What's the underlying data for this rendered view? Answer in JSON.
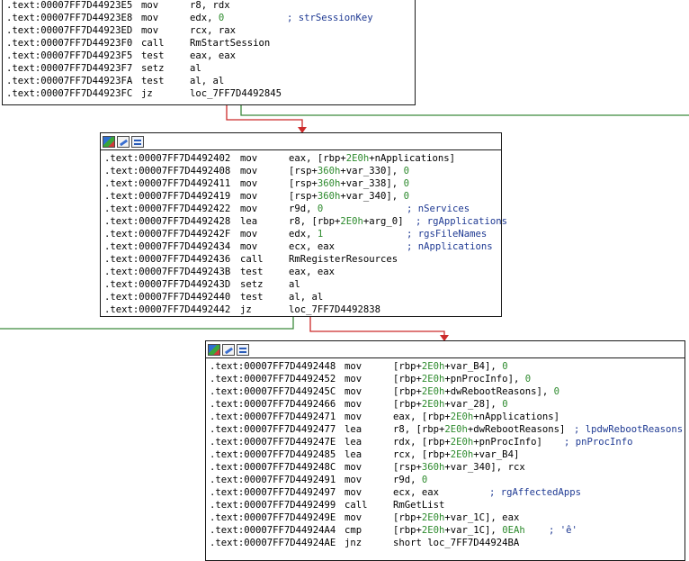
{
  "colors": {
    "edge_true": "#3c8a3c",
    "edge_false": "#cc2a2a",
    "border": "#1a1a1a",
    "text": "#000000",
    "number": "#2d8a2d",
    "comment": "#1f3a93"
  },
  "toolbar_icons": [
    "color-icon",
    "edit-node-icon",
    "graph-view-icon"
  ],
  "blocks": [
    {
      "id": "block1",
      "lines": [
        {
          "addr": ".text:00007FF7D44923E5",
          "mnem": "mov",
          "ops": "r8, rdx",
          "comment": ""
        },
        {
          "addr": ".text:00007FF7D44923E8",
          "mnem": "mov",
          "ops": "edx, 0",
          "comment": "; strSessionKey"
        },
        {
          "addr": ".text:00007FF7D44923ED",
          "mnem": "mov",
          "ops": "rcx, rax",
          "comment": ""
        },
        {
          "addr": ".text:00007FF7D44923F0",
          "mnem": "call",
          "ops": "RmStartSession",
          "comment": ""
        },
        {
          "addr": ".text:00007FF7D44923F5",
          "mnem": "test",
          "ops": "eax, eax",
          "comment": ""
        },
        {
          "addr": ".text:00007FF7D44923F7",
          "mnem": "setz",
          "ops": "al",
          "comment": ""
        },
        {
          "addr": ".text:00007FF7D44923FA",
          "mnem": "test",
          "ops": "al, al",
          "comment": ""
        },
        {
          "addr": ".text:00007FF7D44923FC",
          "mnem": "jz",
          "ops": "loc_7FF7D4492845",
          "comment": ""
        }
      ]
    },
    {
      "id": "block2",
      "lines": [
        {
          "addr": ".text:00007FF7D4492402",
          "mnem": "mov",
          "ops": "eax, [rbp+2E0h+nApplications]",
          "comment": ""
        },
        {
          "addr": ".text:00007FF7D4492408",
          "mnem": "mov",
          "ops": "[rsp+360h+var_330], 0",
          "comment": ""
        },
        {
          "addr": ".text:00007FF7D4492411",
          "mnem": "mov",
          "ops": "[rsp+360h+var_338], 0",
          "comment": ""
        },
        {
          "addr": ".text:00007FF7D4492419",
          "mnem": "mov",
          "ops": "[rsp+360h+var_340], 0",
          "comment": ""
        },
        {
          "addr": ".text:00007FF7D4492422",
          "mnem": "mov",
          "ops": "r9d, 0",
          "comment": "; nServices"
        },
        {
          "addr": ".text:00007FF7D4492428",
          "mnem": "lea",
          "ops": "r8, [rbp+2E0h+arg_0]",
          "comment": "; rgApplications"
        },
        {
          "addr": ".text:00007FF7D449242F",
          "mnem": "mov",
          "ops": "edx, 1",
          "comment": "; rgsFileNames"
        },
        {
          "addr": ".text:00007FF7D4492434",
          "mnem": "mov",
          "ops": "ecx, eax",
          "comment": "; nApplications"
        },
        {
          "addr": ".text:00007FF7D4492436",
          "mnem": "call",
          "ops": "RmRegisterResources",
          "comment": ""
        },
        {
          "addr": ".text:00007FF7D449243B",
          "mnem": "test",
          "ops": "eax, eax",
          "comment": ""
        },
        {
          "addr": ".text:00007FF7D449243D",
          "mnem": "setz",
          "ops": "al",
          "comment": ""
        },
        {
          "addr": ".text:00007FF7D4492440",
          "mnem": "test",
          "ops": "al, al",
          "comment": ""
        },
        {
          "addr": ".text:00007FF7D4492442",
          "mnem": "jz",
          "ops": "loc_7FF7D4492838",
          "comment": ""
        }
      ]
    },
    {
      "id": "block3",
      "lines": [
        {
          "addr": ".text:00007FF7D4492448",
          "mnem": "mov",
          "ops": "[rbp+2E0h+var_B4], 0",
          "comment": ""
        },
        {
          "addr": ".text:00007FF7D4492452",
          "mnem": "mov",
          "ops": "[rbp+2E0h+pnProcInfo], 0",
          "comment": ""
        },
        {
          "addr": ".text:00007FF7D449245C",
          "mnem": "mov",
          "ops": "[rbp+2E0h+dwRebootReasons], 0",
          "comment": ""
        },
        {
          "addr": ".text:00007FF7D4492466",
          "mnem": "mov",
          "ops": "[rbp+2E0h+var_28], 0",
          "comment": ""
        },
        {
          "addr": ".text:00007FF7D4492471",
          "mnem": "mov",
          "ops": "eax, [rbp+2E0h+nApplications]",
          "comment": ""
        },
        {
          "addr": ".text:00007FF7D4492477",
          "mnem": "lea",
          "ops": "r8, [rbp+2E0h+dwRebootReasons]",
          "comment": "; lpdwRebootReasons"
        },
        {
          "addr": ".text:00007FF7D449247E",
          "mnem": "lea",
          "ops": "rdx, [rbp+2E0h+pnProcInfo]",
          "comment": "; pnProcInfo"
        },
        {
          "addr": ".text:00007FF7D4492485",
          "mnem": "lea",
          "ops": "rcx, [rbp+2E0h+var_B4]",
          "comment": ""
        },
        {
          "addr": ".text:00007FF7D449248C",
          "mnem": "mov",
          "ops": "[rsp+360h+var_340], rcx",
          "comment": ""
        },
        {
          "addr": ".text:00007FF7D4492491",
          "mnem": "mov",
          "ops": "r9d, 0",
          "comment": ""
        },
        {
          "addr": ".text:00007FF7D4492497",
          "mnem": "mov",
          "ops": "ecx, eax",
          "comment": "; rgAffectedApps"
        },
        {
          "addr": ".text:00007FF7D4492499",
          "mnem": "call",
          "ops": "RmGetList",
          "comment": ""
        },
        {
          "addr": ".text:00007FF7D449249E",
          "mnem": "mov",
          "ops": "[rbp+2E0h+var_1C], eax",
          "comment": ""
        },
        {
          "addr": ".text:00007FF7D44924A4",
          "mnem": "cmp",
          "ops": "[rbp+2E0h+var_1C], 0EAh",
          "comment": "; 'ê'"
        },
        {
          "addr": ".text:00007FF7D44924AE",
          "mnem": "jnz",
          "ops": "short loc_7FF7D44924BA",
          "comment": ""
        }
      ]
    }
  ]
}
